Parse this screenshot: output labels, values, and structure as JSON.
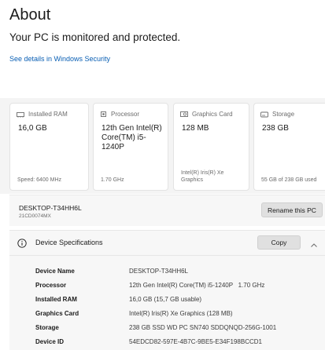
{
  "page": {
    "title": "About",
    "status": "Your PC is monitored and protected.",
    "security_link": "See details in Windows Security"
  },
  "cards": [
    {
      "label": "Installed RAM",
      "icon": "ram-icon",
      "value": "16,0 GB",
      "footer": "Speed: 6400 MHz"
    },
    {
      "label": "Processor",
      "icon": "processor-icon",
      "value": "12th Gen Intel(R) Core(TM) i5-1240P",
      "footer": "1.70 GHz"
    },
    {
      "label": "Graphics Card",
      "icon": "graphics-card-icon",
      "value": "128 MB",
      "footer": "Intel(R) Iris(R) Xe Graphics"
    },
    {
      "label": "Storage",
      "icon": "storage-icon",
      "value": "238 GB",
      "footer": "55 GB of 238 GB used"
    }
  ],
  "device": {
    "name": "DESKTOP-T34HH6L",
    "model": "21CD0074MX",
    "rename_label": "Rename this PC"
  },
  "specs": {
    "title": "Device Specifications",
    "copy_label": "Copy",
    "rows": [
      {
        "label": "Device Name",
        "value": "DESKTOP-T34HH6L"
      },
      {
        "label": "Processor",
        "value": "12th Gen Intel(R) Core(TM) i5-1240P   1.70 GHz"
      },
      {
        "label": "Installed RAM",
        "value": "16,0 GB (15,7 GB usable)"
      },
      {
        "label": "Graphics Card",
        "value": "Intel(R) Iris(R) Xe Graphics (128 MB)"
      },
      {
        "label": "Storage",
        "value": "238 GB SSD WD PC SN740 SDDQNQD-256G-1001"
      },
      {
        "label": "Device ID",
        "value": "54EDCD82-597E-4B7C-9BE5-E34F198BCCD1"
      }
    ]
  },
  "colors": {
    "link": "#0a5fb4",
    "panel_bg": "#f7f7f7",
    "button_bg": "#e0e0e0"
  }
}
